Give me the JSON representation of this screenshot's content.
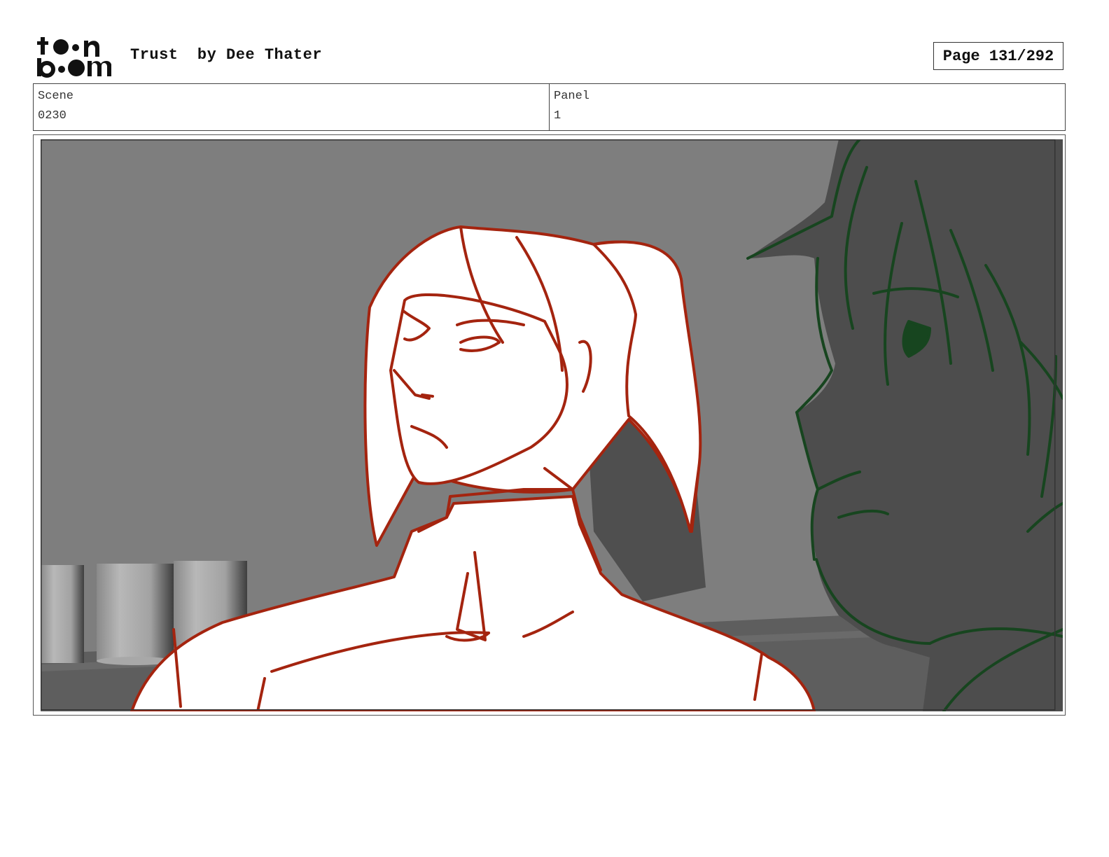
{
  "header": {
    "logo": {
      "text_top": "toon",
      "text_bottom": "boom"
    },
    "title": "Trust  by Dee Thater",
    "page": "Page 131/292"
  },
  "info": {
    "scene_label": "Scene",
    "scene_value": "0230",
    "panel_label": "Panel",
    "panel_value": "1"
  },
  "panel_image": {
    "subject": "storyboard-sketch",
    "colors": {
      "background": "#7e7e7e",
      "foreground_character_line": "#a4240f",
      "background_character_line": "#17451f",
      "background_character_fill": "#4d4d4d"
    }
  }
}
